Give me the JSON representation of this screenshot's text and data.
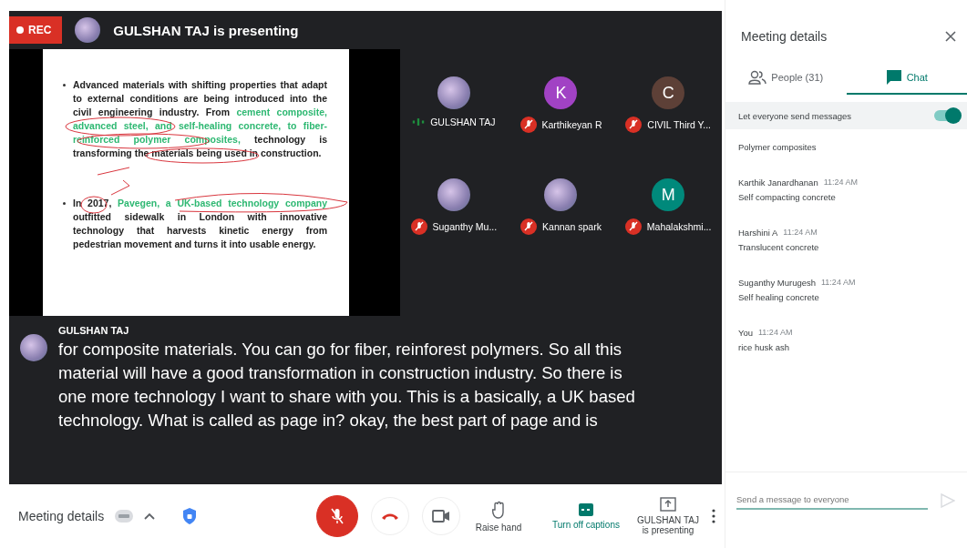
{
  "recording": {
    "label": "REC",
    "on": true
  },
  "presenter_banner": {
    "text": "GULSHAN TAJ is presenting"
  },
  "slide": {
    "bullets": [
      {
        "segments": [
          {
            "text": "Advanced materials with shifting properties that adapt to external conditions are being introduced into the civil engineering industry. From ",
            "highlight": false
          },
          {
            "text": "cement composite, advanced steel, and self-healing concrete, to fiber-reinforced polymer composites,",
            "highlight": true
          },
          {
            "text": " technology is transforming the materials being used in construction.",
            "highlight": false
          }
        ]
      },
      {
        "segments": [
          {
            "text": "In 2017, ",
            "highlight": false
          },
          {
            "text": "Pavegen, a UK-based technology company",
            "highlight": true
          },
          {
            "text": " outfitted sidewalk in London with innovative technology that harvests kinetic energy from pedestrian movement and turns it into usable energy.",
            "highlight": false
          }
        ]
      }
    ]
  },
  "participants": [
    {
      "name": "GULSHAN TAJ",
      "kind": "photo",
      "muted": false
    },
    {
      "name": "Karthikeyan R",
      "kind": "letter",
      "initial": "K",
      "color": "#a142c4",
      "muted": true
    },
    {
      "name": "CIVIL Third Y...",
      "kind": "letter",
      "initial": "C",
      "color": "#5d4037",
      "muted": true
    },
    {
      "name": "Suganthy Mu...",
      "kind": "photo",
      "muted": true
    },
    {
      "name": "Kannan spark",
      "kind": "photo",
      "muted": true
    },
    {
      "name": "Mahalakshmi...",
      "kind": "letter",
      "initial": "M",
      "color": "#00897b",
      "muted": true
    }
  ],
  "caption": {
    "speaker": "GULSHAN TAJ",
    "text": "for composite materials. You can go for fiber, reinforest polymers. So all this material will have a good transformation in construction industry. So there is one more technology I want to share with you. This is a basically, a UK based technology. What is called as page in? okay, the best part of page and is"
  },
  "panel": {
    "title": "Meeting details",
    "tabs": [
      {
        "label": "People (31)",
        "kind": "people",
        "selected": false
      },
      {
        "label": "Chat",
        "kind": "chat",
        "selected": true
      }
    ],
    "toggle": {
      "label": "Let everyone send messages",
      "on": true
    },
    "messages": [
      {
        "text": "Polymer composites"
      },
      {
        "sender": "Karthik Janardhanan",
        "time": "11:24 AM",
        "text": "Self compacting concrete"
      },
      {
        "sender": "Harshini A",
        "time": "11:24 AM",
        "text": "Translucent concrete"
      },
      {
        "sender": "Suganthy Murugesh",
        "time": "11:24 AM",
        "text": "Self healing concrete"
      },
      {
        "sender": "You",
        "time": "11:24 AM",
        "text": "rice husk ash"
      }
    ],
    "input": {
      "placeholder": "Send a message to everyone"
    }
  },
  "toolbar": {
    "meeting_details": "Meeting details",
    "mic_muted": true,
    "actions": [
      {
        "kind": "hand",
        "label": "Raise hand",
        "active": false
      },
      {
        "kind": "captions",
        "label": "Turn off captions",
        "active": true
      },
      {
        "kind": "present",
        "label": "GULSHAN TAJ is presenting",
        "active": false
      }
    ]
  }
}
